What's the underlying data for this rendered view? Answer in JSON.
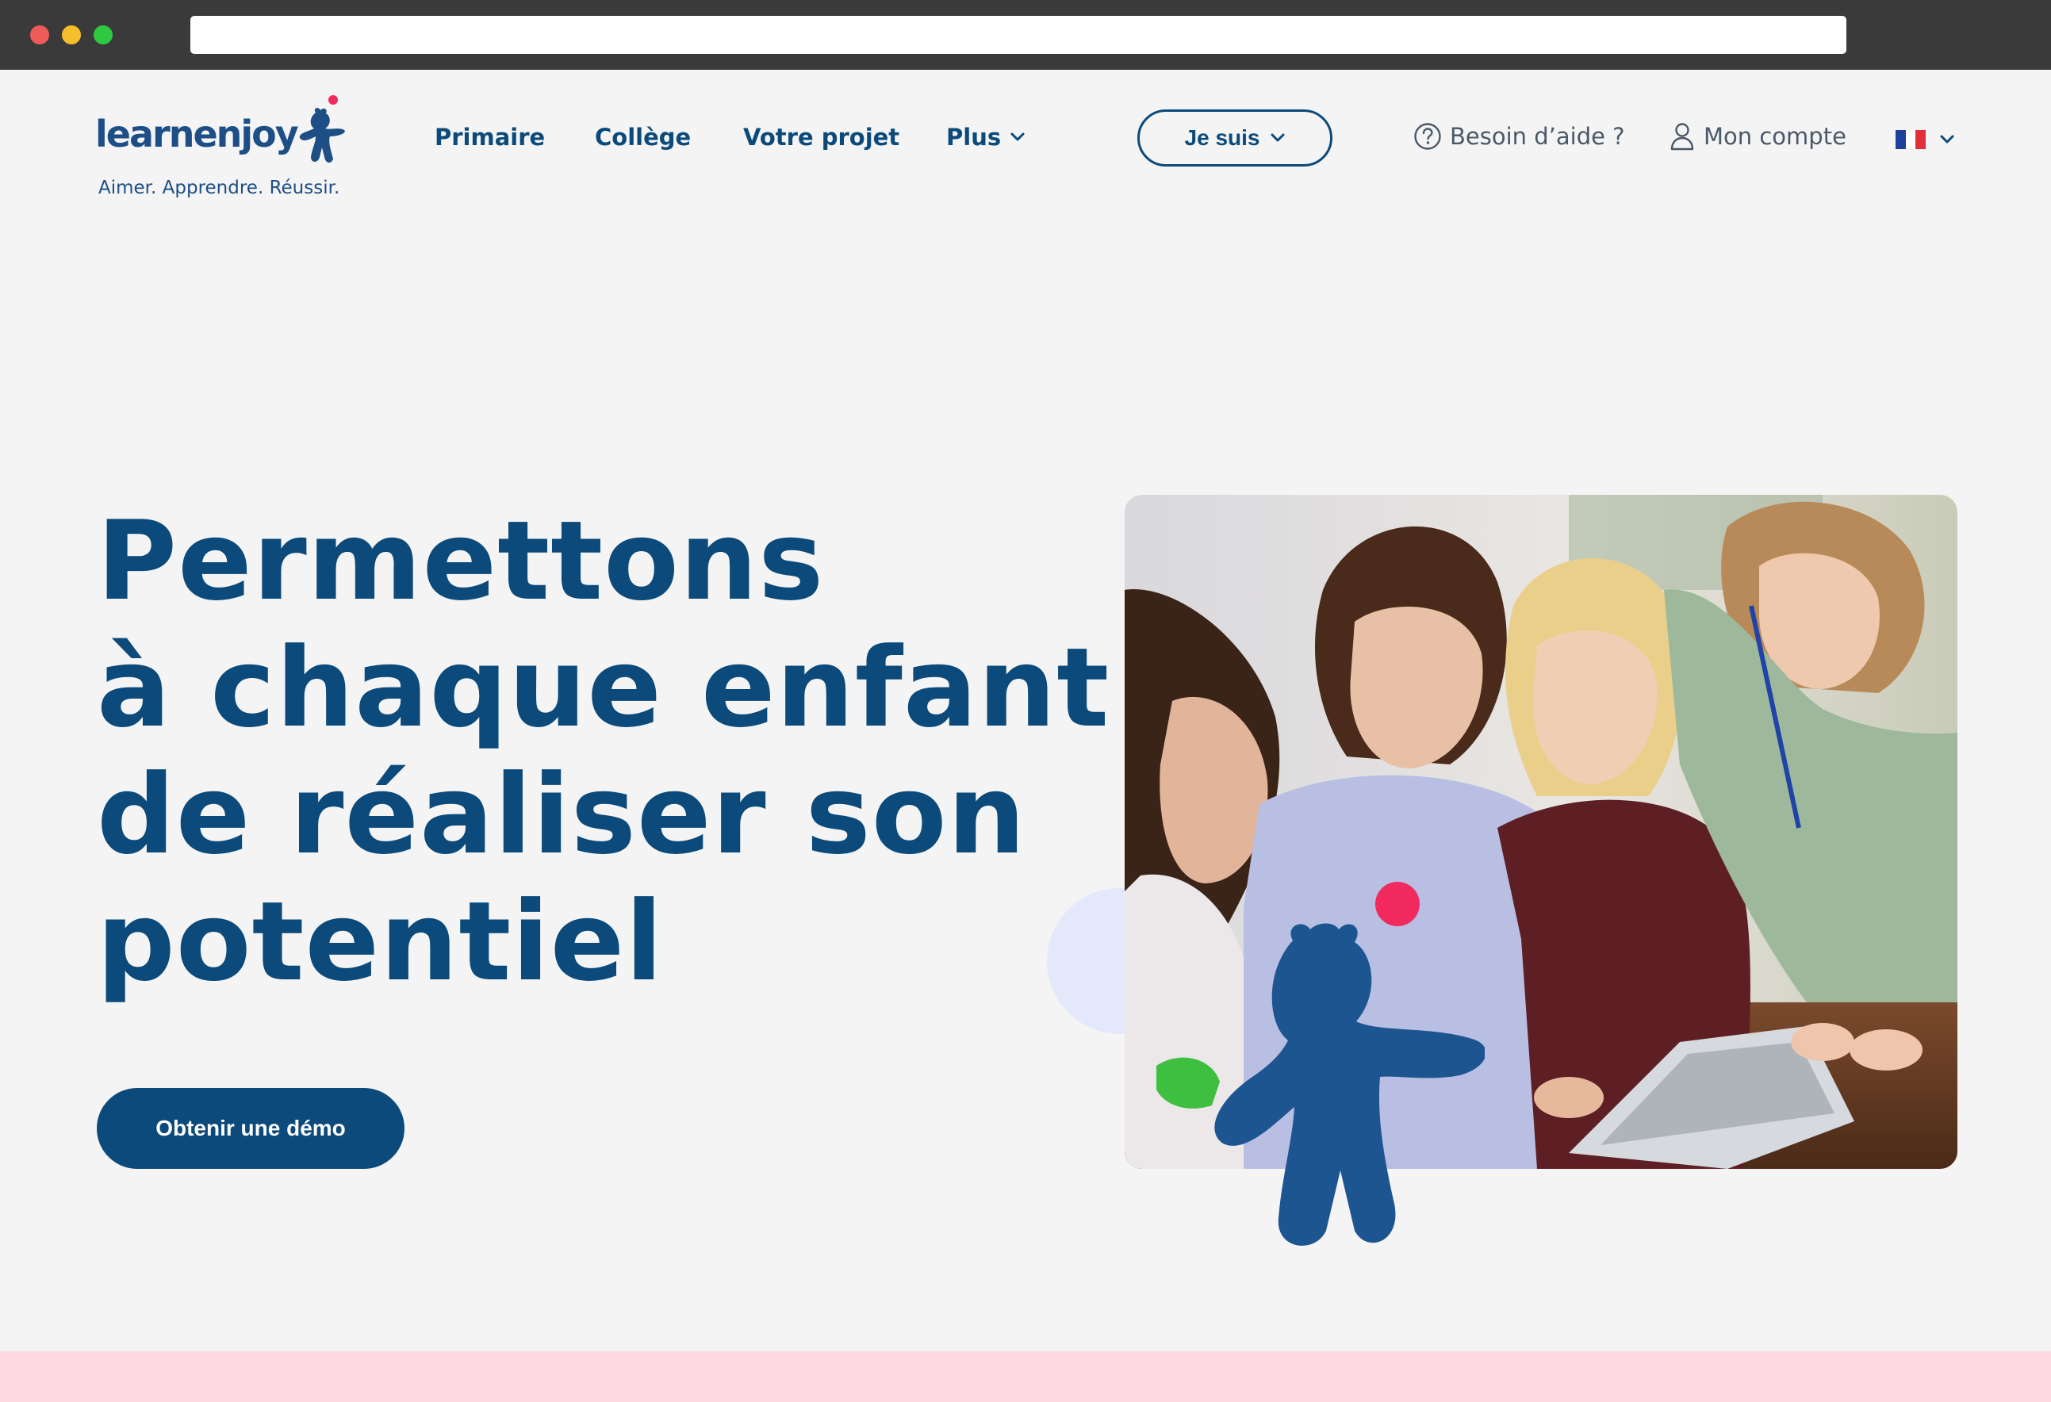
{
  "browser": {
    "window_controls": [
      "close",
      "minimize",
      "maximize"
    ],
    "url": ""
  },
  "header": {
    "logo": {
      "wordmark": "learnenjoy",
      "tagline": "Aimer. Apprendre. Réussir."
    },
    "nav": {
      "primaire": "Primaire",
      "college": "Collège",
      "projet": "Votre projet",
      "plus": "Plus"
    },
    "je_suis": "Je suis",
    "help": "Besoin d’aide ?",
    "account": "Mon compte",
    "language": "FR"
  },
  "hero": {
    "title_lines": [
      "Permettons",
      "à chaque enfant",
      "de réaliser son",
      "potentiel"
    ],
    "cta": "Obtenir une démo",
    "photo_alt": "Enseignante et élèves regardant une tablette"
  },
  "colors": {
    "brand_blue": "#0b4a7a",
    "accent_pink": "#f0295e",
    "background": "#f4f4f4",
    "pink_band": "#fdd9e3",
    "bubble": "#e3e8fb"
  },
  "icons": {
    "help": "question-circle-icon",
    "account": "user-icon",
    "dropdown": "chevron-down-icon",
    "flag": "france-flag-icon"
  }
}
